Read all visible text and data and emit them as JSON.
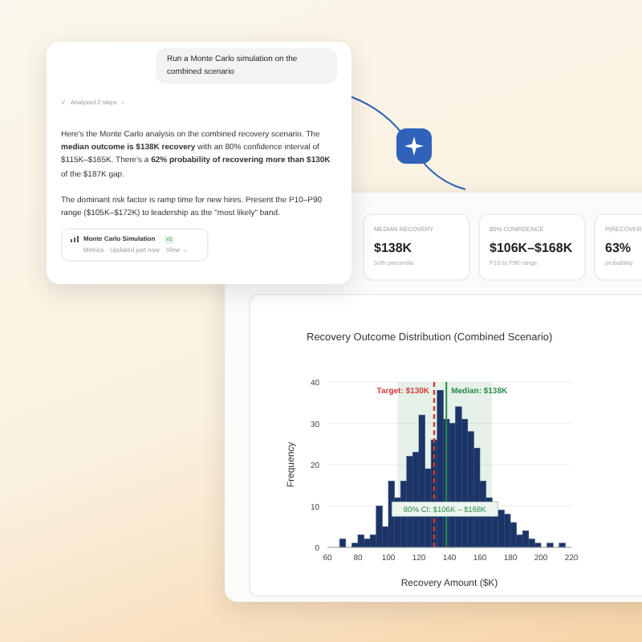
{
  "chat": {
    "user_message": "Run a Monte Carlo simulation on the combined scenario",
    "steps": {
      "icon": "✓",
      "label": "Analyzed 2 steps",
      "chevron": "›"
    },
    "paragraphs": [
      "Here's the Monte Carlo analysis on the combined recovery scenario. The **median outcome is $138K recovery** with an 80% confidence interval of $115K–$165K. There's a **62% probability of recovering more than $130K** of the $187K gap.",
      "The dominant risk factor is ramp time for new hires. Present the P10–P90 range ($105K–$172K) to leadership as the \"most likely\" band."
    ],
    "artifact": {
      "title": "Monte Carlo Simulation",
      "version": "v1",
      "subtitle": "Metrics · Updated just now",
      "link": "View →"
    }
  },
  "metrics": [
    {
      "label": "MEDIAN RECOVERY",
      "value": "$138K",
      "note": "50th percentile"
    },
    {
      "label": "80% CONFIDENCE",
      "value": "$106K–$168K",
      "note": "P10 to P90 range"
    },
    {
      "label": "P(RECOVER",
      "value": "63%",
      "note": "probability"
    }
  ],
  "chart": {
    "chart_data": {
      "type": "bar",
      "title": "Recovery Outcome Distribution (Combined Scenario)",
      "xlabel": "Recovery Amount ($K)",
      "ylabel": "Frequency",
      "x": [
        70,
        74,
        78,
        82,
        86,
        90,
        94,
        98,
        102,
        106,
        110,
        114,
        118,
        122,
        126,
        130,
        134,
        138,
        142,
        146,
        150,
        154,
        158,
        162,
        166,
        170,
        174,
        178,
        182,
        186,
        190,
        194,
        198,
        202,
        206,
        210,
        214
      ],
      "series": [
        {
          "color": "#1c3466",
          "values": [
            2,
            0,
            1,
            3,
            2,
            3,
            10,
            5,
            16,
            12,
            16,
            22,
            23,
            32,
            19,
            26,
            38,
            31,
            30,
            34,
            31,
            28,
            24,
            16,
            12,
            8,
            9,
            8,
            6,
            3,
            4,
            2,
            1,
            0,
            1,
            0,
            1
          ]
        }
      ],
      "xlim": [
        60,
        220
      ],
      "ylim": [
        0,
        40
      ],
      "xticks": [
        60,
        80,
        100,
        120,
        140,
        160,
        180,
        200,
        220
      ],
      "yticks": [
        0,
        10,
        20,
        30,
        40
      ],
      "grid": true,
      "ref_lines": [
        {
          "axis": "x",
          "value": 130,
          "label": "Target: $130K",
          "color": "#d33a3a"
        },
        {
          "axis": "x",
          "value": 138,
          "label": "Median: $138K",
          "color": "#2a8a4a"
        }
      ],
      "bands": [
        {
          "axis": "x",
          "from": 106,
          "to": 168,
          "label": "80% CI: $106K – $168K",
          "color": "#2a8a4a"
        }
      ]
    }
  }
}
